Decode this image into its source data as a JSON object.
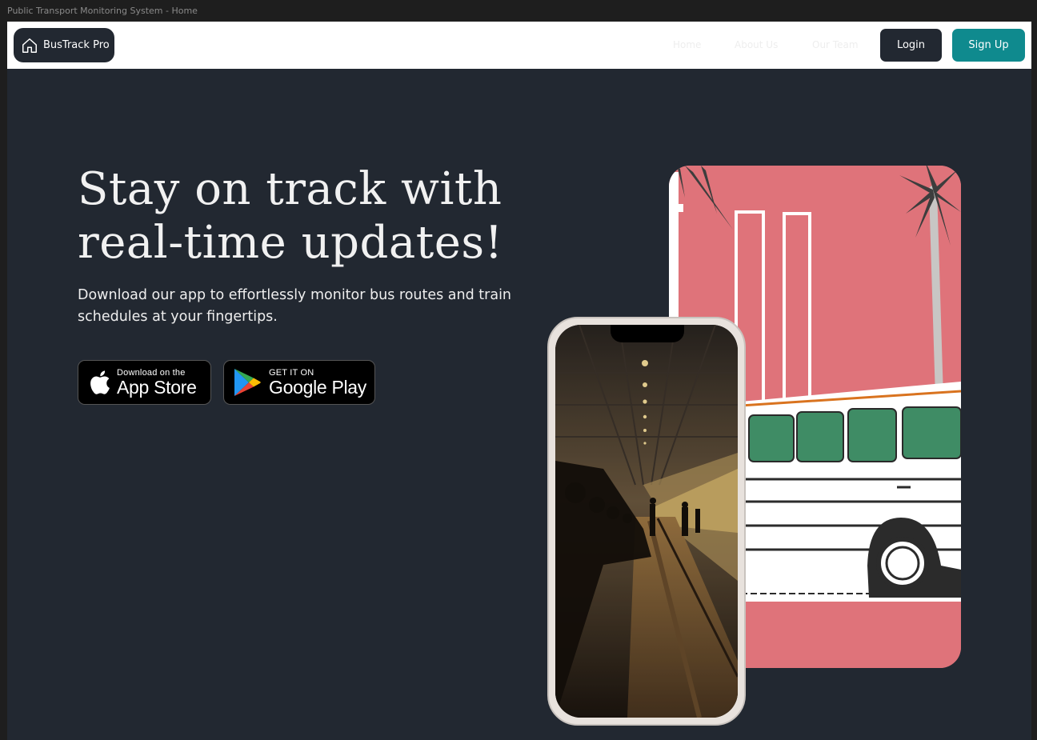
{
  "window": {
    "title": "Public Transport Monitoring System - Home"
  },
  "navbar": {
    "brand": "BusTrack Pro",
    "links": [
      "Home",
      "About Us",
      "Our Team"
    ],
    "login_label": "Login",
    "signup_label": "Sign Up"
  },
  "hero": {
    "title_line1": "Stay on track with",
    "title_line2": "real-time updates!",
    "subtitle": "Download our app to effortlessly monitor bus routes and train schedules at your fingertips."
  },
  "stores": {
    "appstore_small": "Download on the",
    "appstore_big": "App Store",
    "play_small": "GET IT ON",
    "play_big": "Google Play"
  },
  "colors": {
    "background": "#222831",
    "accent": "#0f8a8e",
    "art_background": "#df737a"
  },
  "icons": {
    "brand": "home-icon",
    "appstore": "apple-icon",
    "playstore": "google-play-icon"
  }
}
